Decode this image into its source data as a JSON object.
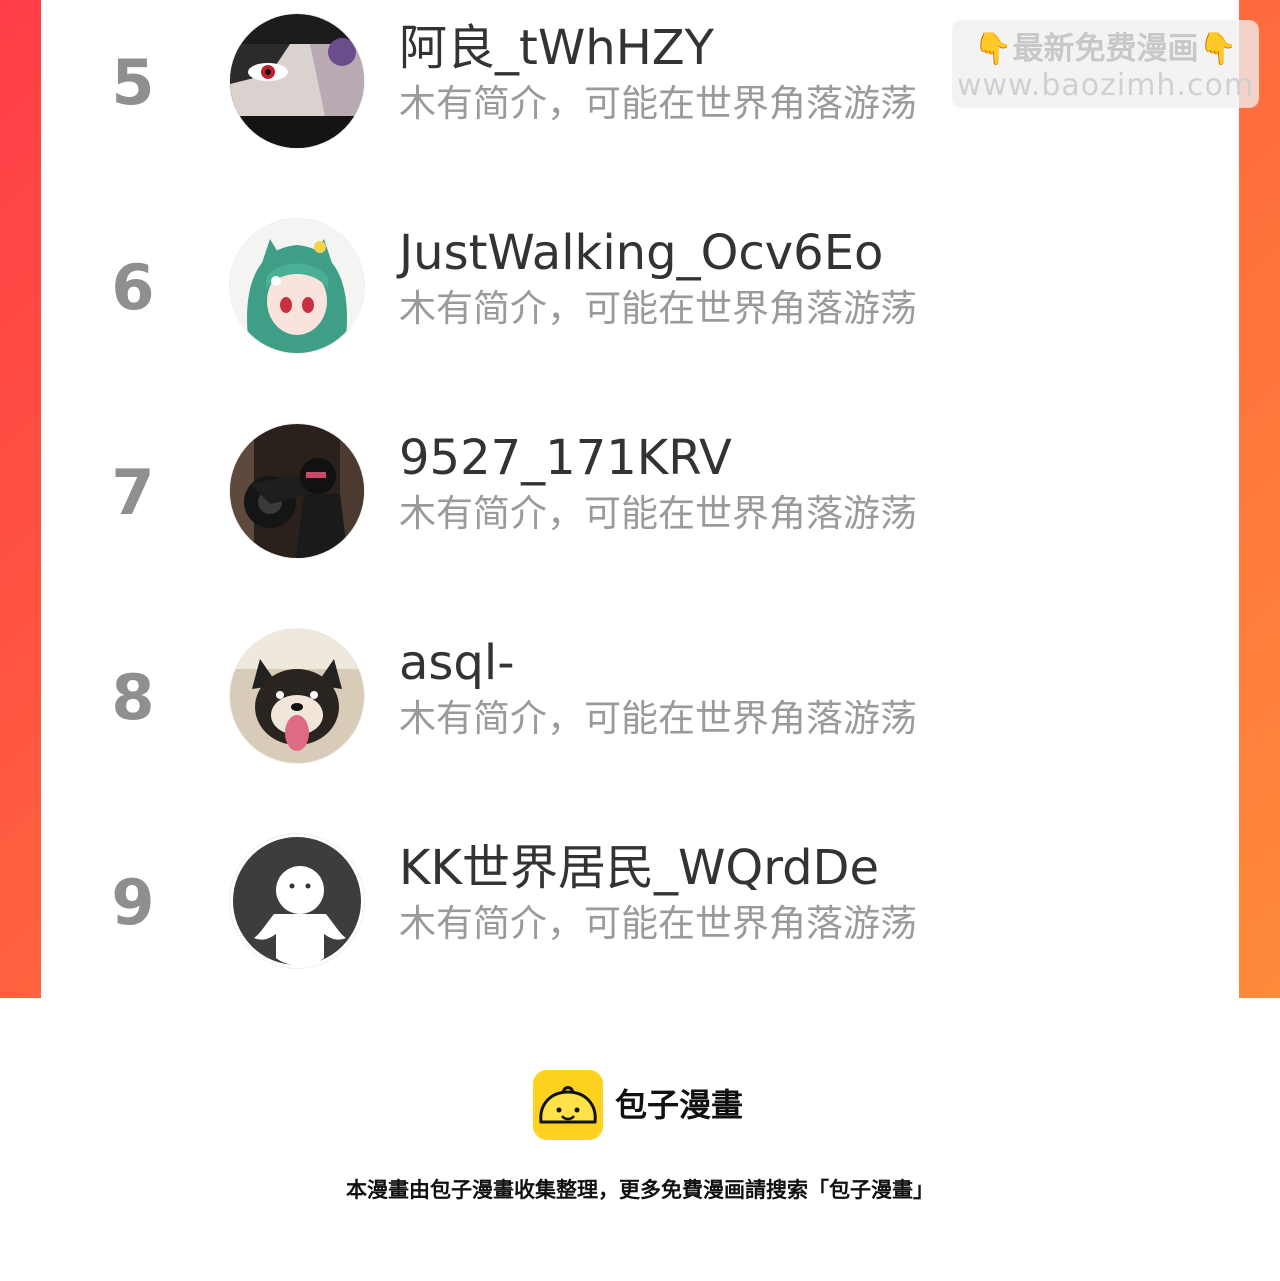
{
  "ranking": {
    "items": [
      {
        "rank": "5",
        "name": "阿良_tWhHZY",
        "bio": "木有简介，可能在世界角落游荡",
        "avatar_icon": "anime-eye-avatar-icon"
      },
      {
        "rank": "6",
        "name": "JustWalking_Ocv6Eo",
        "bio": "木有简介，可能在世界角落游荡",
        "avatar_icon": "green-hair-girl-avatar-icon"
      },
      {
        "rank": "7",
        "name": "9527_171KRV",
        "bio": "木有简介，可能在世界角落游荡",
        "avatar_icon": "motorcycle-rider-avatar-icon"
      },
      {
        "rank": "8",
        "name": "asql-",
        "bio": "木有简介，可能在世界角落游荡",
        "avatar_icon": "dog-tongue-avatar-icon"
      },
      {
        "rank": "9",
        "name": "KK世界居民_WQrdDe",
        "bio": "木有简介，可能在世界角落游荡",
        "avatar_icon": "default-ghost-avatar-icon"
      }
    ]
  },
  "watermark": {
    "left_hand": "👇",
    "title": "最新免费漫画",
    "right_hand": "👇",
    "url": "www.baozimh.com"
  },
  "footer": {
    "brand": "包子漫畫",
    "note": "本漫畫由包子漫畫收集整理，更多免費漫画請搜索「包子漫畫」",
    "logo_icon": "baozi-bun-logo-icon"
  },
  "colors": {
    "frame_start": "#ff3d47",
    "frame_end": "#ff8a3a",
    "rank_gray": "#8f8f8f",
    "name_text": "#333333",
    "bio_text": "#9a9a9a",
    "logo_yellow": "#ffd21f"
  }
}
